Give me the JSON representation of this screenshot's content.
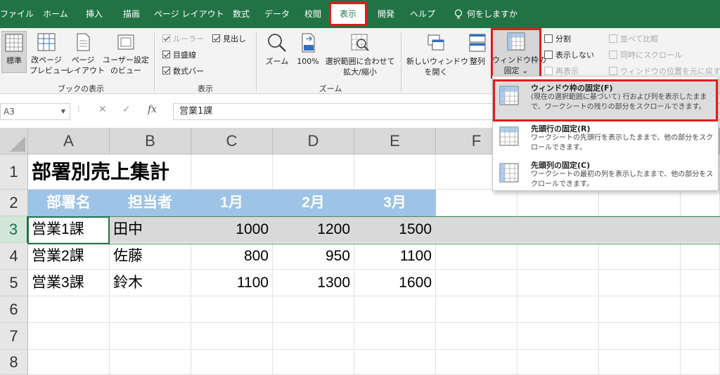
{
  "menu": {
    "tabs": [
      "ファイル",
      "ホーム",
      "挿入",
      "描画",
      "ページ レイアウト",
      "数式",
      "データ",
      "校閲",
      "表示",
      "開発",
      "ヘルプ"
    ],
    "tell_me": "何をしますか"
  },
  "ribbon": {
    "book_views": {
      "normal": "標準",
      "page_break_1": "改ページ",
      "page_break_2": "プレビュー",
      "page_layout_1": "ページ",
      "page_layout_2": "レイアウト",
      "custom_1": "ユーザー設定",
      "custom_2": "のビュー",
      "group": "ブックの表示"
    },
    "show": {
      "ruler": "ルーラー",
      "headings": "見出し",
      "gridlines": "目盛線",
      "formula_bar": "数式バー",
      "group": "表示"
    },
    "zoom": {
      "zoom": "ズーム",
      "hundred": "100%",
      "zoom_sel_1": "選択範囲に合わせて",
      "zoom_sel_2": "拡大/縮小",
      "group": "ズーム"
    },
    "window": {
      "new_window_1": "新しいウィンドウ",
      "new_window_2": "を開く",
      "arrange": "整列",
      "freeze_1": "ウィンドウ枠の",
      "freeze_2": "固定 ⌄",
      "split": "分割",
      "hide": "表示しない",
      "unhide": "再表示",
      "side_by_side": "並べて比較",
      "sync_scroll": "同時にスクロール",
      "reset_pos": "ウィンドウの位置を元に戻す"
    }
  },
  "formula_bar": {
    "name_box": "A3",
    "fx": "fx",
    "content": "営業1課"
  },
  "grid": {
    "columns": [
      "A",
      "B",
      "C",
      "D",
      "E",
      "F"
    ],
    "rows": [
      "1",
      "2",
      "3",
      "4",
      "5",
      "6",
      "7",
      "8"
    ],
    "title": "部署別売上集計",
    "headers": [
      "部署名",
      "担当者",
      "1月",
      "2月",
      "3月"
    ],
    "data": [
      [
        "営業1課",
        "田中",
        "1000",
        "1200",
        "1500"
      ],
      [
        "営業2課",
        "佐藤",
        "800",
        "950",
        "1100"
      ],
      [
        "営業3課",
        "鈴木",
        "1100",
        "1300",
        "1600"
      ]
    ]
  },
  "dropdown": {
    "items": [
      {
        "title": "ウィンドウ枠の固定(F)",
        "desc": "(現在の選択範囲に基づいて) 行および列を表示したままで、ワークシートの残りの部分をスクロールできます。"
      },
      {
        "title": "先頭行の固定(R)",
        "desc": "ワークシートの先頭行を表示したままで、他の部分をスクロールできます。"
      },
      {
        "title": "先頭列の固定(C)",
        "desc": "ワークシートの最初の列を表示したままで、他の部分をスクロールできます。"
      }
    ]
  },
  "colors": {
    "excel_green": "#217346",
    "header_fill": "#9dc3e6",
    "highlight_red": "#e01b1b"
  }
}
